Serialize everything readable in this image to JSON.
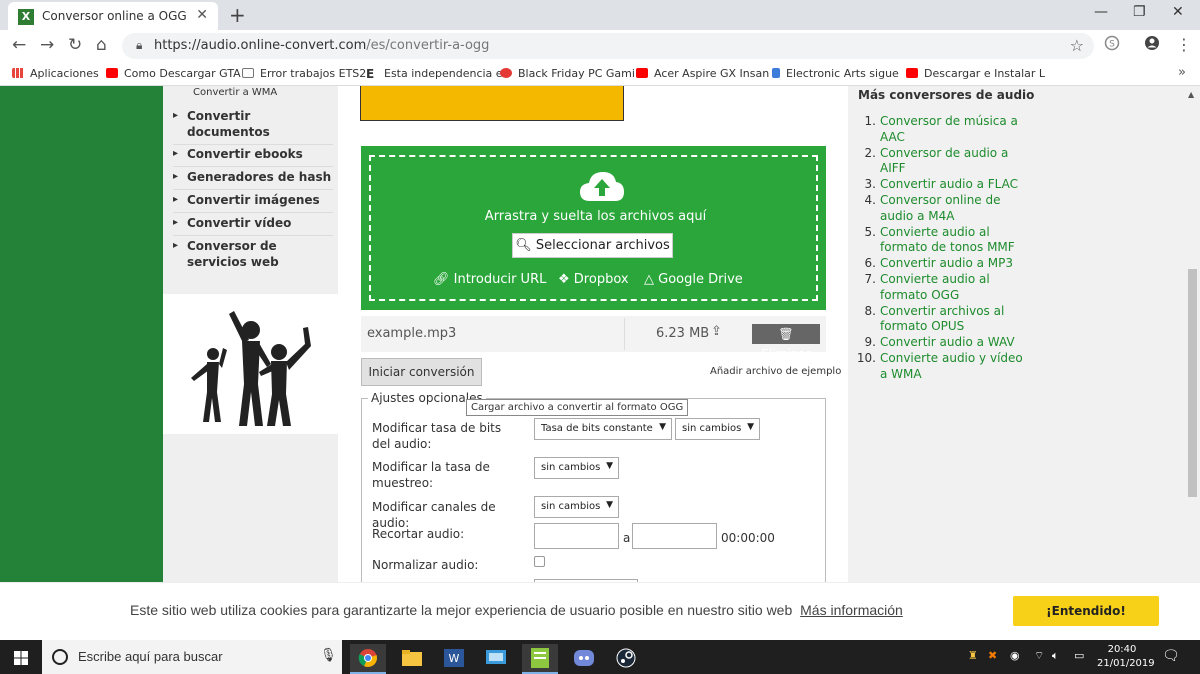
{
  "browser": {
    "tab_title": "Conversor online a OGG",
    "tab_close": "✕",
    "new_tab": "+",
    "url_host": "https://audio.online-convert.com",
    "url_path": "/es/convertir-a-ogg",
    "bookmarks": [
      {
        "label": "Aplicaciones",
        "icon": "apps-grid-icon",
        "color": "#e8453c"
      },
      {
        "label": "Como Descargar GTA",
        "icon": "youtube-icon",
        "color": "#ff0000"
      },
      {
        "label": "Error trabajos ETS2",
        "icon": "page-icon",
        "color": "#ffffff"
      },
      {
        "label": "Esta independencia e",
        "icon": "e-icon",
        "color": "#000000"
      },
      {
        "label": "Black Friday PC Gami",
        "icon": "spiral-icon",
        "color": "#e53935"
      },
      {
        "label": "Acer Aspire GX Insan",
        "icon": "youtube-icon",
        "color": "#ff0000"
      },
      {
        "label": "Electronic Arts sigue",
        "icon": "figure-icon",
        "color": "#3b7dd8"
      },
      {
        "label": "Descargar e Instalar L",
        "icon": "youtube-icon",
        "color": "#ff0000"
      }
    ],
    "bookmarks_more": "»"
  },
  "sidebar": {
    "top_item": "Convertir a WMA",
    "items": [
      {
        "label": "Convertir documentos"
      },
      {
        "label": "Convertir ebooks"
      },
      {
        "label": "Generadores de hash"
      },
      {
        "label": "Convertir imágenes"
      },
      {
        "label": "Convertir vídeo"
      },
      {
        "label": "Conversor de servicios web"
      }
    ]
  },
  "upload": {
    "drop_text": "Arrastra y suelta los archivos aquí",
    "select_button": "Seleccionar archivos",
    "url_link": "Introducir URL",
    "dropbox_link": "Dropbox",
    "gdrive_link": "Google Drive"
  },
  "file": {
    "name": "example.mp3",
    "size": "6.23 MB",
    "delete_label": "Eliminar"
  },
  "actions": {
    "start_button": "Iniciar conversión",
    "add_sample": "Añadir archivo de ejemplo",
    "tooltip": "Cargar archivo a convertir al formato OGG"
  },
  "settings": {
    "legend": "Ajustes opcionales",
    "bitrate_label": "Modificar tasa de bits del audio:",
    "bitrate_mode": "Tasa de bits constante",
    "bitrate_value": "sin cambios",
    "samplerate_label": "Modificar la tasa de muestreo:",
    "samplerate_value": "sin cambios",
    "channels_label": "Modificar canales de audio:",
    "channels_value": "sin cambios",
    "trim_label": "Recortar audio:",
    "trim_sep": "a",
    "trim_time": "00:00:00",
    "normalize_label": "Normalizar audio:"
  },
  "right": {
    "title": "Más conversores de audio",
    "items": [
      {
        "num": "1.",
        "label": "Conversor de música a AAC"
      },
      {
        "num": "2.",
        "label": "Conversor de audio a AIFF"
      },
      {
        "num": "3.",
        "label": "Convertir audio a FLAC"
      },
      {
        "num": "4.",
        "label": "Conversor online de audio a M4A"
      },
      {
        "num": "5.",
        "label": "Convierte audio al formato de tonos MMF"
      },
      {
        "num": "6.",
        "label": "Convertir audio a MP3"
      },
      {
        "num": "7.",
        "label": "Convierte audio al formato OGG"
      },
      {
        "num": "8.",
        "label": "Convertir archivos al formato OPUS"
      },
      {
        "num": "9.",
        "label": "Convertir audio a WAV"
      },
      {
        "num": "10.",
        "label": "Convierte audio y vídeo a WMA"
      }
    ]
  },
  "cookie": {
    "text": "Este sitio web utiliza cookies para garantizarte la mejor experiencia de usuario posible en nuestro sitio web",
    "link": "Más información",
    "button": "¡Entendido!"
  },
  "taskbar": {
    "search_placeholder": "Escribe aquí para buscar",
    "time": "20:40",
    "date": "21/01/2019"
  },
  "colors": {
    "brand_green": "#238238",
    "dropzone_green": "#2aa63a",
    "link_green": "#1e8c2d",
    "cookie_button": "#f7d117"
  }
}
